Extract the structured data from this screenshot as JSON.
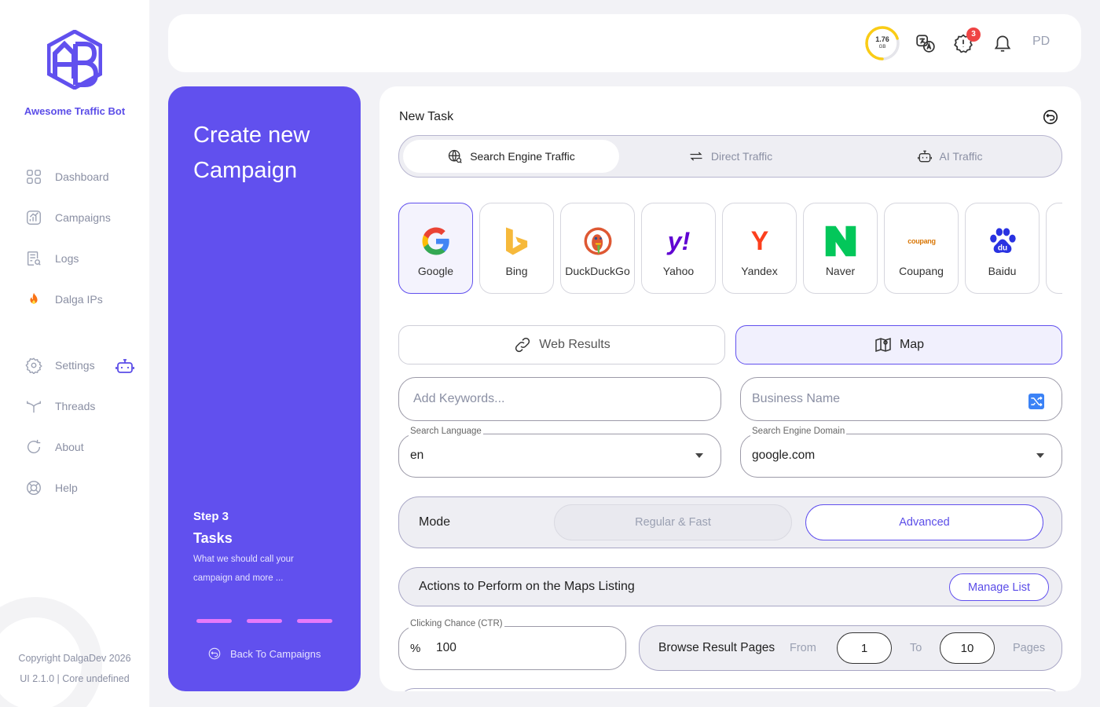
{
  "app": {
    "brand_name": "Awesome Traffic Bot",
    "accent_color": "#6150ee"
  },
  "sidebar": {
    "items": [
      {
        "label": "Dashboard",
        "icon": "dashboard-grid-icon"
      },
      {
        "label": "Campaigns",
        "icon": "campaign-chart-icon"
      },
      {
        "label": "Logs",
        "icon": "logs-document-icon"
      },
      {
        "label": "Dalga IPs",
        "icon": "fire-icon"
      },
      {
        "label": "Settings",
        "icon": "gear-icon"
      },
      {
        "label": "Threads",
        "icon": "threads-branch-icon"
      },
      {
        "label": "About",
        "icon": "refresh-circle-icon"
      },
      {
        "label": "Help",
        "icon": "lifebuoy-icon"
      }
    ],
    "copyright": "Copyright DalgaDev 2026",
    "version": "UI 2.1.0 | Core undefined"
  },
  "topbar": {
    "usage_value": "1.76",
    "usage_unit": "GB",
    "usage_fraction": 0.7,
    "alert_count": "3",
    "user_initials": "PD"
  },
  "campaign_panel": {
    "title": "Create new Campaign",
    "step_label": "Step 3",
    "step_name": "Tasks",
    "step_description": "What we should call your campaign and more ...",
    "progress_steps": 3,
    "back_label": "Back To Campaigns"
  },
  "task": {
    "title": "New Task",
    "traffic_tabs": [
      {
        "label": "Search Engine Traffic",
        "icon": "globe-search-icon",
        "active": true
      },
      {
        "label": "Direct Traffic",
        "icon": "arrows-right-icon",
        "active": false
      },
      {
        "label": "AI Traffic",
        "icon": "robot-icon",
        "active": false
      }
    ],
    "engines": [
      {
        "name": "Google",
        "active": true
      },
      {
        "name": "Bing",
        "active": false
      },
      {
        "name": "DuckDuckGo",
        "active": false
      },
      {
        "name": "Yahoo",
        "active": false
      },
      {
        "name": "Yandex",
        "active": false
      },
      {
        "name": "Naver",
        "active": false
      },
      {
        "name": "Coupang",
        "active": false
      },
      {
        "name": "Baidu",
        "active": false
      }
    ],
    "engine_logo_text": {
      "google": "G",
      "yahoo": "y!",
      "yandex": "Y",
      "naver": "N",
      "coupang": "coupang",
      "baidu": "du"
    },
    "result_types": [
      {
        "label": "Web Results",
        "active": false
      },
      {
        "label": "Map",
        "active": true
      }
    ],
    "keywords_placeholder": "Add Keywords...",
    "business_name_placeholder": "Business Name",
    "search_language": {
      "label": "Search Language",
      "value": "en"
    },
    "search_domain": {
      "label": "Search Engine Domain",
      "value": "google.com"
    },
    "mode": {
      "label": "Mode",
      "options": [
        "Regular & Fast",
        "Advanced"
      ],
      "selected": "Advanced"
    },
    "actions": {
      "label": "Actions to Perform on the Maps Listing",
      "button": "Manage List"
    },
    "ctr": {
      "label": "Clicking Chance (CTR)",
      "prefix": "%",
      "value": "100"
    },
    "browse": {
      "label": "Browse Result Pages",
      "from_label": "From",
      "from_value": "1",
      "to_label": "To",
      "to_value": "10",
      "unit": "Pages"
    }
  }
}
